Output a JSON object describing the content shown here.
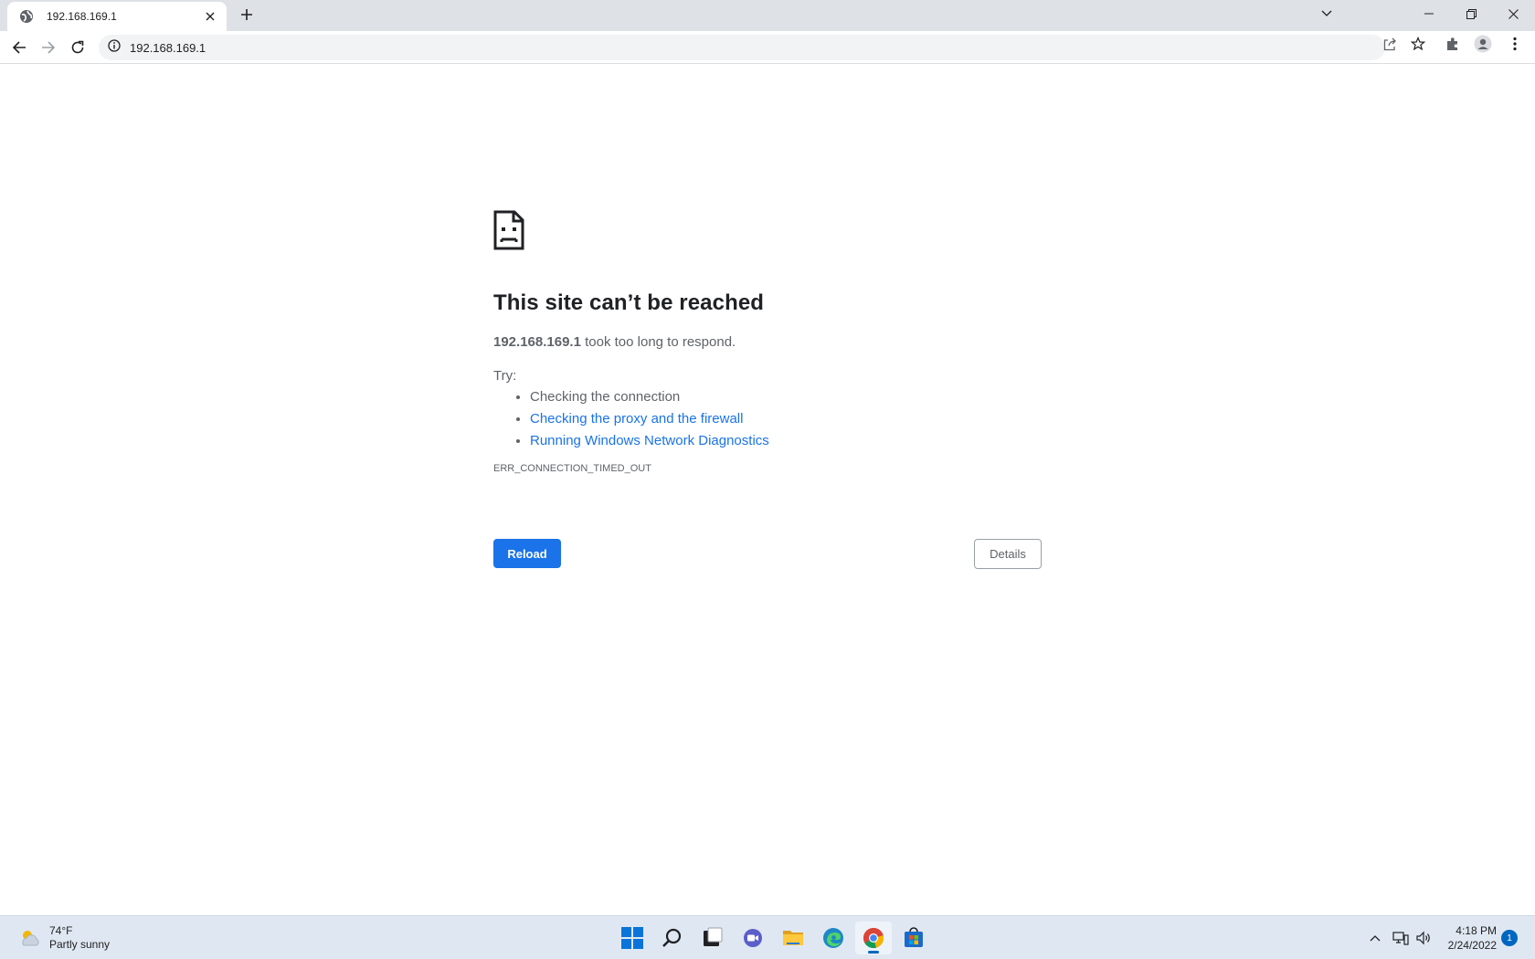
{
  "browser": {
    "tab": {
      "title": "192.168.169.1",
      "close_label": "×"
    },
    "new_tab_label": "+",
    "omnibox": {
      "url": "192.168.169.1"
    }
  },
  "error_page": {
    "heading": "This site can’t be reached",
    "host": "192.168.169.1",
    "message_suffix": " took too long to respond.",
    "try_label": "Try:",
    "suggestions": [
      {
        "text": "Checking the connection",
        "is_link": false
      },
      {
        "text": "Checking the proxy and the firewall",
        "is_link": true
      },
      {
        "text": "Running Windows Network Diagnostics",
        "is_link": true
      }
    ],
    "error_code": "ERR_CONNECTION_TIMED_OUT",
    "reload_label": "Reload",
    "details_label": "Details"
  },
  "taskbar": {
    "weather": {
      "temp": "74°F",
      "condition": "Partly sunny"
    },
    "clock": {
      "time": "4:18 PM",
      "date": "2/24/2022"
    },
    "notification_count": "1",
    "apps": [
      "start-icon",
      "search-icon",
      "task-view-icon",
      "chat-icon",
      "file-explorer-icon",
      "edge-icon",
      "chrome-icon",
      "store-icon"
    ]
  },
  "colors": {
    "accent": "#1a73e8",
    "text": "#202124",
    "muted": "#5f6368",
    "taskbar_accent": "#0067c0"
  }
}
